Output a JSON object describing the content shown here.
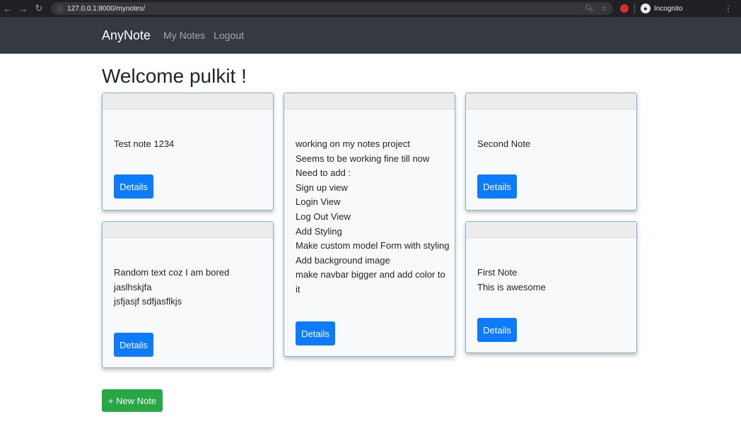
{
  "browser": {
    "url": "127.0.0.1:8000/mynotes/",
    "profile_label": "Incognito"
  },
  "navbar": {
    "brand": "AnyNote",
    "links": [
      "My Notes",
      "Logout"
    ]
  },
  "page": {
    "welcome": "Welcome pulkit !"
  },
  "notes": [
    {
      "text": "Test note 1234",
      "button": "Details"
    },
    {
      "text": "working on my notes project\nSeems to be working fine till now\nNeed to add :\nSign up view\nLogin View\nLog Out View\nAdd Styling\nMake custom model Form with styling\nAdd background image\nmake navbar bigger and add color to\nit",
      "button": "Details"
    },
    {
      "text": "Second Note",
      "button": "Details"
    },
    {
      "text": "Random text coz I am bored\njaslhskjfa\njsfjasjf sdfjasflkjs",
      "button": "Details"
    },
    {
      "text": "First Note\nThis is awesome",
      "button": "Details"
    }
  ],
  "actions": {
    "new_note": "+ New Note"
  }
}
